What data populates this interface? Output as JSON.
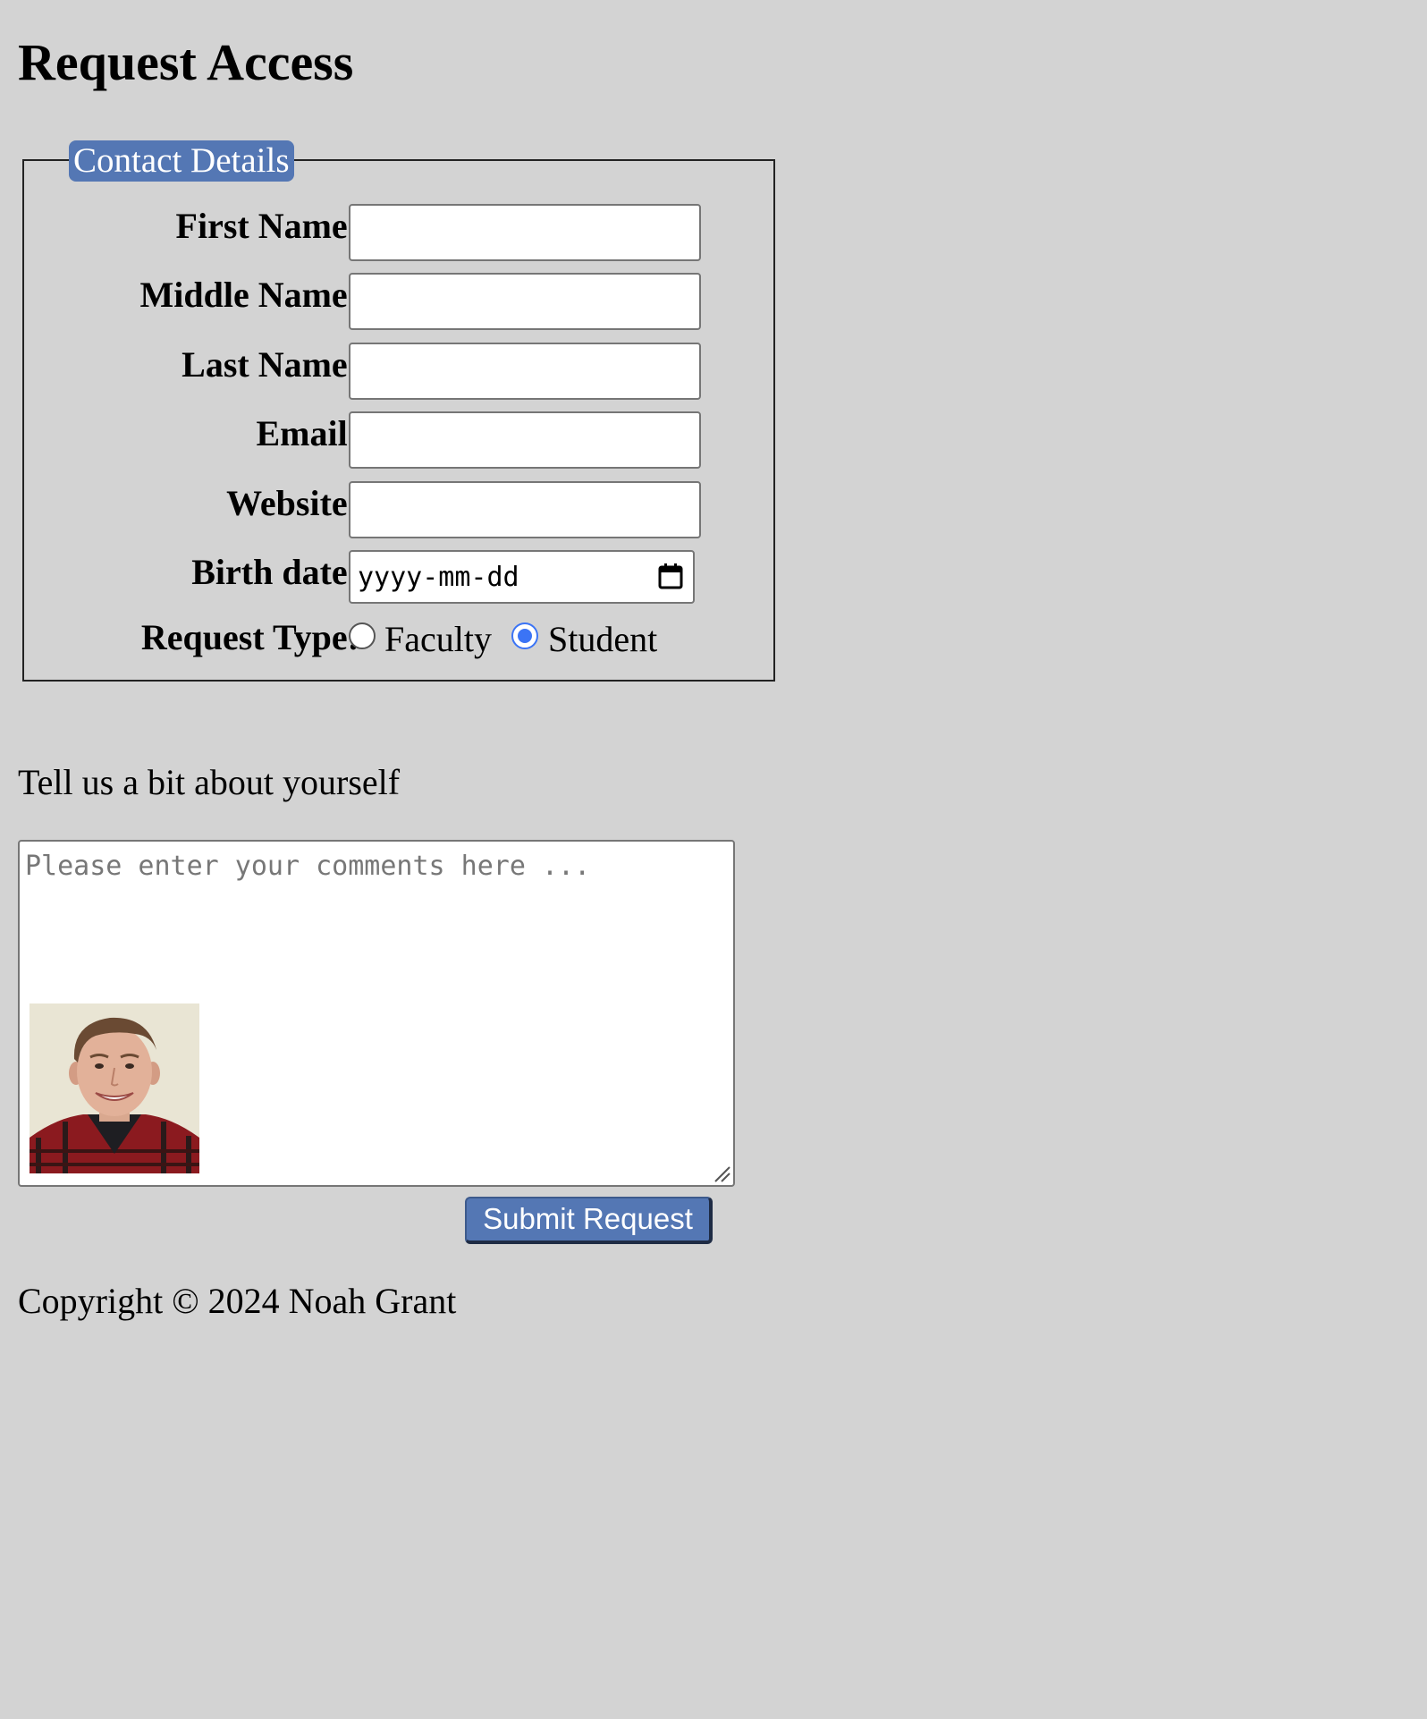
{
  "page": {
    "title": "Request Access"
  },
  "fieldset": {
    "legend": "Contact Details",
    "fields": {
      "first_name": {
        "label": "First Name:",
        "value": ""
      },
      "middle_name": {
        "label": "Middle Name:",
        "value": ""
      },
      "last_name": {
        "label": "Last Name:",
        "value": ""
      },
      "email": {
        "label": "Email:",
        "value": ""
      },
      "website": {
        "label": "Website:",
        "value": ""
      },
      "birth_date": {
        "label": "Birth date:",
        "placeholder": "yyyy-mm-dd"
      }
    },
    "request_type": {
      "label": "Request Type:",
      "options": [
        {
          "label": "Faculty",
          "checked": false
        },
        {
          "label": "Student",
          "checked": true
        }
      ]
    }
  },
  "about": {
    "heading": "Tell us a bit about yourself",
    "comments_placeholder": "Please enter your comments here ..."
  },
  "submit": {
    "label": "Submit Request"
  },
  "footer": {
    "copyright": "Copyright © 2024 Noah Grant"
  },
  "colors": {
    "background": "#d3d3d3",
    "accent": "#5477b4",
    "radio_selected": "#3b74f5"
  }
}
